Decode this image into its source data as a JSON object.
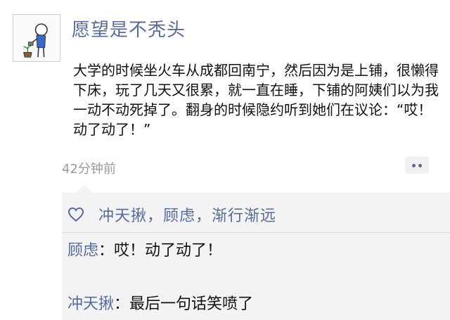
{
  "post": {
    "author": "愿望是不秃头",
    "text": "大学的时候坐火车从成都回南宁，然后因为是上铺，很懒得下床，玩了几天又很累，就一直在睡，下铺的阿姨们以为我一动不动死掉了。翻身的时候隐约听到她们在议论：“哎！动了动了！”",
    "timestamp": "42分钟前"
  },
  "likes": {
    "names": "冲天揪，顾虑，渐行渐远"
  },
  "comments": [
    {
      "name": "顾虑",
      "text": "：哎！动了动了！"
    },
    {
      "name": "冲天揪",
      "text": "：最后一句话笑喷了"
    }
  ],
  "colors": {
    "link_blue": "#586b95",
    "comment_bg": "#f3f3f5",
    "timestamp_gray": "#9a9a9a"
  },
  "icons": {
    "avatar": "stick-figure-watering-plant",
    "likes": "heart-outline-icon",
    "more": "more-dots-icon"
  }
}
